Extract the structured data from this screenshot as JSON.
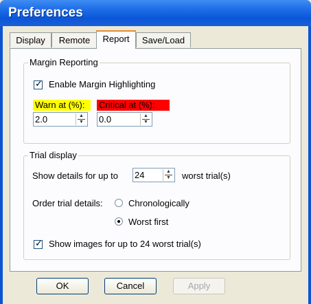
{
  "window": {
    "title": "Preferences"
  },
  "tabs": [
    {
      "label": "Display"
    },
    {
      "label": "Remote"
    },
    {
      "label": "Report"
    },
    {
      "label": "Save/Load"
    }
  ],
  "margin_reporting": {
    "group_label": "Margin Reporting",
    "enable_label": "Enable Margin Highlighting",
    "enable_checked": true,
    "warn_label": "Warn at (%):",
    "warn_value": "2.0",
    "warn_color": "#ffff00",
    "critical_label": "Critical at (%):",
    "critical_value": "0.0",
    "critical_color": "#ff0000"
  },
  "trial_display": {
    "group_label": "Trial display",
    "show_details_prefix": "Show details for up to",
    "show_details_value": "24",
    "show_details_suffix": "worst trial(s)",
    "order_label": "Order trial details:",
    "option_chrono": "Chronologically",
    "option_worst": "Worst first",
    "selected_option": "Worst first",
    "show_images_label": "Show images for up to 24 worst trial(s)",
    "show_images_checked": true
  },
  "buttons": {
    "ok": "OK",
    "cancel": "Cancel",
    "apply": "Apply"
  }
}
